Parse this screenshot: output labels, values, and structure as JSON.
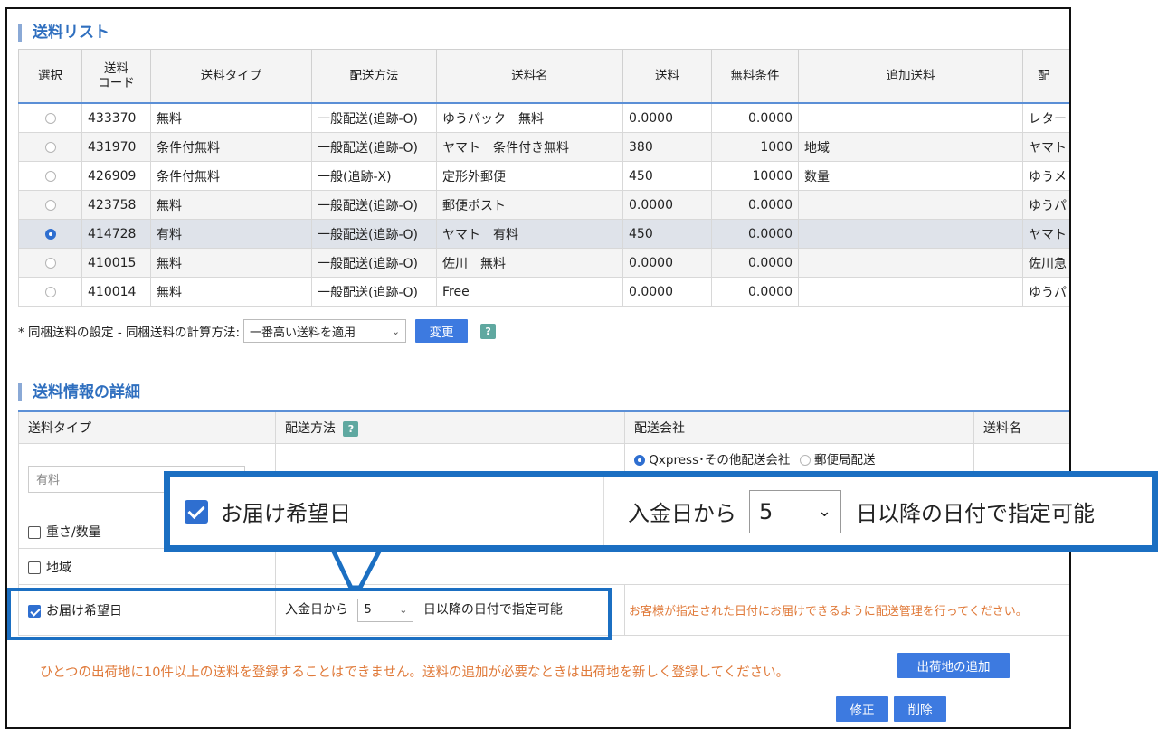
{
  "list_section": {
    "title": "送料リスト",
    "columns": [
      "選択",
      "送料\nコード",
      "送料タイプ",
      "配送方法",
      "送料名",
      "送料",
      "無料条件",
      "追加送料",
      "配"
    ],
    "rows": [
      {
        "selected": false,
        "code": "433370",
        "type": "無料",
        "method": "一般配送(追跡-O)",
        "name": "ゆうパック　無料",
        "fee": "0.0000",
        "free_cond": "0.0000",
        "extra": "",
        "last": "レター"
      },
      {
        "selected": false,
        "code": "431970",
        "type": "条件付無料",
        "method": "一般配送(追跡-O)",
        "name": "ヤマト　条件付き無料",
        "fee": "380",
        "free_cond": "1000",
        "extra": "地域",
        "last": "ヤマト"
      },
      {
        "selected": false,
        "code": "426909",
        "type": "条件付無料",
        "method": "一般(追跡-X)",
        "name": "定形外郵便",
        "fee": "450",
        "free_cond": "10000",
        "extra": "数量",
        "last": "ゆうメ"
      },
      {
        "selected": false,
        "code": "423758",
        "type": "無料",
        "method": "一般配送(追跡-O)",
        "name": "郵便ポスト",
        "fee": "0.0000",
        "free_cond": "0.0000",
        "extra": "",
        "last": "ゆうパ"
      },
      {
        "selected": true,
        "code": "414728",
        "type": "有料",
        "method": "一般配送(追跡-O)",
        "name": "ヤマト　有料",
        "fee": "450",
        "free_cond": "0.0000",
        "extra": "",
        "last": "ヤマト"
      },
      {
        "selected": false,
        "code": "410015",
        "type": "無料",
        "method": "一般配送(追跡-O)",
        "name": "佐川　無料",
        "fee": "0.0000",
        "free_cond": "0.0000",
        "extra": "",
        "last": "佐川急"
      },
      {
        "selected": false,
        "code": "410014",
        "type": "無料",
        "method": "一般配送(追跡-O)",
        "name": "Free",
        "fee": "0.0000",
        "free_cond": "0.0000",
        "extra": "",
        "last": "ゆうパ"
      }
    ]
  },
  "bundle": {
    "label": "* 同梱送料の設定 - 同梱送料の計算方法:",
    "select_value": "一番高い送料を適用",
    "button": "変更",
    "help": "?"
  },
  "detail_section": {
    "title": "送料情報の詳細",
    "headers": {
      "type": "送料タイプ",
      "method": "配送方法",
      "company": "配送会社",
      "name": "送料名"
    },
    "type_placeholder": "有料",
    "company_options": [
      "Qxpress･その他配送会社",
      "郵便局配送"
    ],
    "weight_label": "重さ/数量",
    "region_label": "地域",
    "delivery_label": "お届け希望日",
    "from_label": "入金日から",
    "days_value": "5",
    "after_label": "日以降の日付で指定可能",
    "note": "お客様が指定された日付にお届けできるように配送管理を行ってください。"
  },
  "warning": "ひとつの出荷地に10件以上の送料を登録することはできません。送料の追加が必要なときは出荷地を新しく登録してください。",
  "buttons": {
    "add_location": "出荷地の追加",
    "edit": "修正",
    "delete": "削除"
  },
  "colors": {
    "accent": "#3d7ae0",
    "callout": "#1b6fc2",
    "warning": "#e07a3a",
    "title": "#2f6fbf"
  }
}
